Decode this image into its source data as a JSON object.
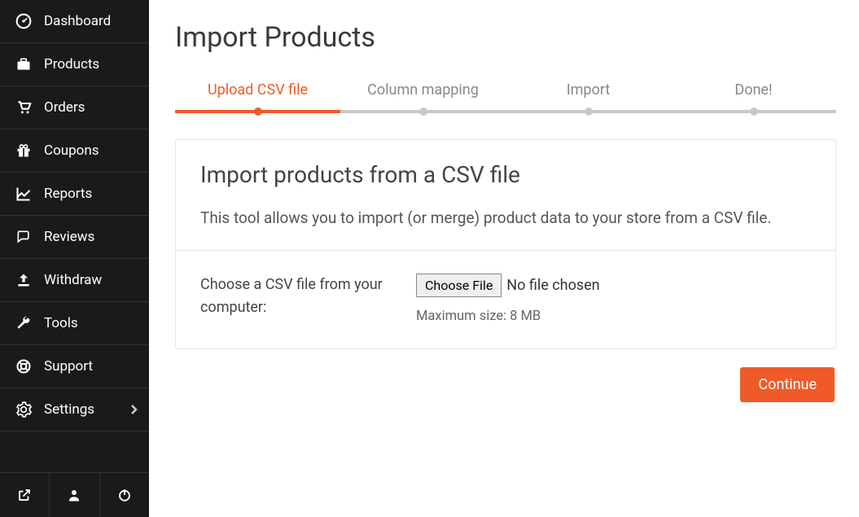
{
  "sidebar": {
    "items": [
      {
        "icon": "dashboard",
        "label": "Dashboard"
      },
      {
        "icon": "briefcase",
        "label": "Products"
      },
      {
        "icon": "cart",
        "label": "Orders"
      },
      {
        "icon": "gift",
        "label": "Coupons"
      },
      {
        "icon": "chart",
        "label": "Reports"
      },
      {
        "icon": "comments",
        "label": "Reviews"
      },
      {
        "icon": "upload",
        "label": "Withdraw"
      },
      {
        "icon": "wrench",
        "label": "Tools"
      },
      {
        "icon": "lifering",
        "label": "Support"
      },
      {
        "icon": "gear",
        "label": "Settings",
        "hasSubmenu": true
      }
    ]
  },
  "page": {
    "title": "Import Products"
  },
  "stepper": {
    "steps": [
      {
        "label": "Upload CSV file",
        "active": true
      },
      {
        "label": "Column mapping",
        "active": false
      },
      {
        "label": "Import",
        "active": false
      },
      {
        "label": "Done!",
        "active": false
      }
    ]
  },
  "form": {
    "heading": "Import products from a CSV file",
    "description": "This tool allows you to import (or merge) product data to your store from a CSV file.",
    "fieldLabel": "Choose a CSV file from your computer:",
    "chooseButton": "Choose File",
    "fileStatus": "No file chosen",
    "hint": "Maximum size: 8 MB",
    "continue": "Continue"
  },
  "colors": {
    "accent": "#f05a28",
    "sidebarBg": "#1a1a1a"
  }
}
